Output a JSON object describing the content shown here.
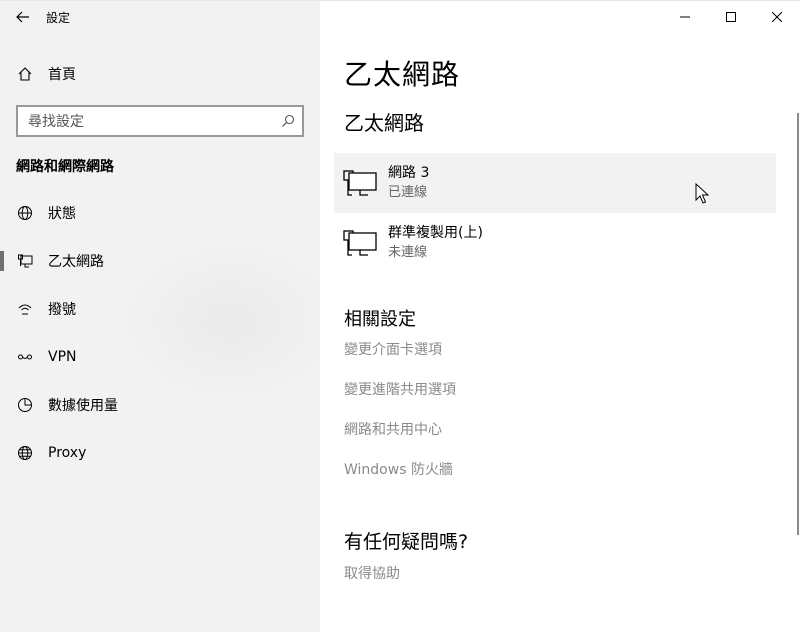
{
  "titlebar": {
    "app_title": "設定"
  },
  "sidebar": {
    "home_label": "首頁",
    "search": {
      "placeholder": "尋找設定"
    },
    "section_title": "網路和網際網路",
    "items": [
      {
        "label": "狀態",
        "icon": "globe-status-icon"
      },
      {
        "label": "乙太網路",
        "icon": "ethernet-icon",
        "selected": true
      },
      {
        "label": "撥號",
        "icon": "dialup-icon"
      },
      {
        "label": "VPN",
        "icon": "vpn-icon"
      },
      {
        "label": "數據使用量",
        "icon": "data-usage-icon"
      },
      {
        "label": "Proxy",
        "icon": "globe-icon"
      }
    ]
  },
  "main": {
    "page_title": "乙太網路",
    "sub_title": "乙太網路",
    "networks": [
      {
        "name": "網路 3",
        "status": "已連線"
      },
      {
        "name": "群準複製用(上)",
        "status": "未連線"
      }
    ],
    "related": {
      "title": "相關設定",
      "links": [
        "變更介面卡選項",
        "變更進階共用選項",
        "網路和共用中心",
        "Windows 防火牆"
      ]
    },
    "question": {
      "title": "有任何疑問嗎?",
      "help_link": "取得協助"
    }
  },
  "colors": {
    "sidebar_bg": "#f2f2f2",
    "hover_bg": "#f2f2f2",
    "link_gray": "#8a8a8a",
    "selection_bar": "#707070"
  }
}
